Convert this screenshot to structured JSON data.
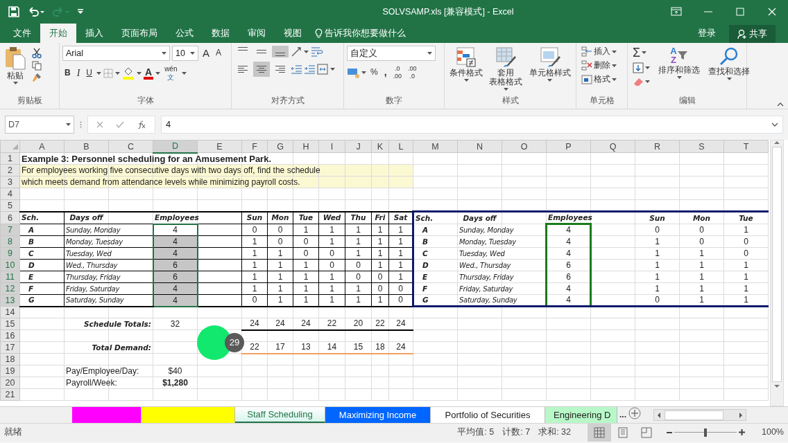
{
  "window": {
    "title": "SOLVSAMP.xls  [兼容模式] - Excel"
  },
  "ribbon_tabs": [
    {
      "label": "文件",
      "selected": false
    },
    {
      "label": "开始",
      "selected": true
    },
    {
      "label": "插入",
      "selected": false
    },
    {
      "label": "页面布局",
      "selected": false
    },
    {
      "label": "公式",
      "selected": false
    },
    {
      "label": "数据",
      "selected": false
    },
    {
      "label": "审阅",
      "selected": false
    },
    {
      "label": "视图",
      "selected": false
    }
  ],
  "tell_me": {
    "placeholder": "告诉我你想要做什么"
  },
  "account": {
    "sign_in": "登录",
    "share": "共享"
  },
  "ribbon": {
    "clipboard": {
      "paste": "粘贴",
      "label": "剪贴板"
    },
    "font": {
      "font_name": "Arial",
      "font_size": "10",
      "grow": "A",
      "shrink": "A",
      "bold": "B",
      "italic": "I",
      "underline": "U",
      "font_color": "A",
      "phonetic": [
        "wén",
        "文"
      ],
      "label": "字体"
    },
    "alignment": {
      "vertical": [
        {
          "selected": false
        },
        {
          "selected": false
        },
        {
          "selected": true
        }
      ],
      "horizontal": [
        {
          "selected": false
        },
        {
          "selected": true
        },
        {
          "selected": false
        }
      ],
      "label": "对齐方式"
    },
    "number": {
      "format": "自定义",
      "percent": "%",
      "comma": ",",
      "decimals": [
        {
          "lines": [
            ".0",
            ".00"
          ]
        },
        {
          "lines": [
            ".00",
            ".0"
          ]
        }
      ],
      "label": "数字"
    },
    "styles": {
      "buttons": [
        {
          "lines": [
            "条件格式"
          ]
        },
        {
          "lines": [
            "套用",
            "表格格式"
          ]
        },
        {
          "lines": [
            "单元格样式"
          ]
        }
      ],
      "label": "样式"
    },
    "cells": {
      "items": [
        "插入",
        "删除",
        "格式"
      ],
      "label": "单元格"
    },
    "editing": {
      "sum": "Σ",
      "sort_letters": [
        "A",
        "Z"
      ],
      "buttons": [
        "排序和筛选",
        "查找和选择"
      ],
      "label": "编辑"
    }
  },
  "formula_bar": {
    "name_box": "D7",
    "formula": "4"
  },
  "columns": [
    {
      "label": "A",
      "selected": false
    },
    {
      "label": "B",
      "selected": false
    },
    {
      "label": "C",
      "selected": false
    },
    {
      "label": "D",
      "selected": true
    },
    {
      "label": "E",
      "selected": false
    },
    {
      "label": "F",
      "selected": false
    },
    {
      "label": "G",
      "selected": false
    },
    {
      "label": "H",
      "selected": false
    },
    {
      "label": "I",
      "selected": false
    },
    {
      "label": "J",
      "selected": false
    },
    {
      "label": "K",
      "selected": false
    },
    {
      "label": "L",
      "selected": false
    },
    {
      "label": "M",
      "selected": false
    },
    {
      "label": "N",
      "selected": false
    },
    {
      "label": "O",
      "selected": false
    },
    {
      "label": "P",
      "selected": false
    },
    {
      "label": "Q",
      "selected": false
    },
    {
      "label": "R",
      "selected": false
    },
    {
      "label": "S",
      "selected": false
    },
    {
      "label": "T",
      "selected": false
    }
  ],
  "row_headers": [
    {
      "label": "1",
      "selected": false
    },
    {
      "label": "2",
      "selected": false
    },
    {
      "label": "3",
      "selected": false
    },
    {
      "label": "4",
      "selected": false
    },
    {
      "label": "5",
      "selected": false
    },
    {
      "label": "6",
      "selected": false
    },
    {
      "label": "7",
      "selected": true
    },
    {
      "label": "8",
      "selected": true
    },
    {
      "label": "9",
      "selected": true
    },
    {
      "label": "10",
      "selected": true
    },
    {
      "label": "11",
      "selected": true
    },
    {
      "label": "12",
      "selected": true
    },
    {
      "label": "13",
      "selected": true
    },
    {
      "label": "14",
      "selected": false
    },
    {
      "label": "15",
      "selected": false
    },
    {
      "label": "16",
      "selected": false
    },
    {
      "label": "17",
      "selected": false
    },
    {
      "label": "18",
      "selected": false
    },
    {
      "label": "19",
      "selected": false
    },
    {
      "label": "20",
      "selected": false
    },
    {
      "label": "21",
      "selected": false
    }
  ],
  "sheet": {
    "title": "Example 3:  Personnel scheduling for an Amusement Park.",
    "description": [
      "For employees working five consecutive days with two days off, find the schedule",
      "which meets demand from attendance levels while minimizing payroll costs."
    ],
    "left_table": {
      "headers": {
        "sch": "Sch.",
        "days_off": "Days off",
        "employees": "Employees",
        "days": [
          "Sun",
          "Mon",
          "Tue",
          "Wed",
          "Thu",
          "Fri",
          "Sat"
        ]
      },
      "rows": [
        {
          "sch": "A",
          "days_off": "Sunday, Monday",
          "employees": "4",
          "selected": true,
          "active": true,
          "days": [
            "0",
            "0",
            "1",
            "1",
            "1",
            "1",
            "1"
          ]
        },
        {
          "sch": "B",
          "days_off": "Monday, Tuesday",
          "employees": "4",
          "selected": true,
          "active": false,
          "days": [
            "1",
            "0",
            "0",
            "1",
            "1",
            "1",
            "1"
          ]
        },
        {
          "sch": "C",
          "days_off": "Tuesday, Wed",
          "employees": "4",
          "selected": true,
          "active": false,
          "days": [
            "1",
            "1",
            "0",
            "0",
            "1",
            "1",
            "1"
          ]
        },
        {
          "sch": "D",
          "days_off": "Wed., Thursday",
          "employees": "6",
          "selected": true,
          "active": false,
          "days": [
            "1",
            "1",
            "1",
            "0",
            "0",
            "1",
            "1"
          ]
        },
        {
          "sch": "E",
          "days_off": "Thursday, Friday",
          "employees": "6",
          "selected": true,
          "active": false,
          "days": [
            "1",
            "1",
            "1",
            "1",
            "0",
            "0",
            "1"
          ]
        },
        {
          "sch": "F",
          "days_off": "Friday, Saturday",
          "employees": "4",
          "selected": true,
          "active": false,
          "days": [
            "1",
            "1",
            "1",
            "1",
            "1",
            "0",
            "0"
          ]
        },
        {
          "sch": "G",
          "days_off": "Saturday, Sunday",
          "employees": "4",
          "selected": true,
          "active": false,
          "days": [
            "0",
            "1",
            "1",
            "1",
            "1",
            "1",
            "0"
          ]
        }
      ]
    },
    "right_table": {
      "headers": {
        "sch": "Sch.",
        "days_off": "Days off",
        "employees": "Employees",
        "days": [
          "Sun",
          "Mon",
          "Tue"
        ]
      },
      "rows": [
        {
          "sch": "A",
          "days_off": "Sunday, Monday",
          "employees": "4",
          "days": [
            "0",
            "0",
            "1"
          ]
        },
        {
          "sch": "B",
          "days_off": "Monday, Tuesday",
          "employees": "4",
          "days": [
            "1",
            "0",
            "0"
          ]
        },
        {
          "sch": "C",
          "days_off": "Tuesday, Wed",
          "employees": "4",
          "days": [
            "1",
            "1",
            "0"
          ]
        },
        {
          "sch": "D",
          "days_off": "Wed., Thursday",
          "employees": "6",
          "days": [
            "1",
            "1",
            "1"
          ]
        },
        {
          "sch": "E",
          "days_off": "Thursday, Friday",
          "employees": "6",
          "days": [
            "1",
            "1",
            "1"
          ]
        },
        {
          "sch": "F",
          "days_off": "Friday, Saturday",
          "employees": "4",
          "days": [
            "1",
            "1",
            "1"
          ]
        },
        {
          "sch": "G",
          "days_off": "Saturday, Sunday",
          "employees": "4",
          "days": [
            "0",
            "1",
            "1"
          ]
        }
      ]
    },
    "schedule_totals": {
      "label": "Schedule Totals:",
      "total": "32",
      "days": [
        "24",
        "24",
        "24",
        "22",
        "20",
        "22",
        "24"
      ]
    },
    "total_demand": {
      "label": "Total Demand:",
      "days": [
        "22",
        "17",
        "13",
        "14",
        "15",
        "18",
        "24"
      ]
    },
    "pay_per_day": {
      "label": "Pay/Employee/Day:",
      "value": "$40"
    },
    "payroll": {
      "label": "Payroll/Week:",
      "value": "$1,280"
    }
  },
  "click_marker": {
    "step": "29"
  },
  "sheet_tabs": [
    {
      "color": "#ff00ff",
      "selected": false
    },
    {
      "color": "#ffff00",
      "selected": false
    },
    {
      "label": "Staff Scheduling",
      "color": "#d8f5ee",
      "selected": true
    },
    {
      "label": "Maximizing Income",
      "color": "#0066ff",
      "selected": false
    },
    {
      "label": "Portfolio of Securities",
      "color": "#ffffff",
      "selected": false
    },
    {
      "label": "Engineering D",
      "color": "#b8f8c8",
      "selected": false
    }
  ],
  "more_tabs": "...",
  "status_bar": {
    "state": "就绪",
    "average": "平均值: 5",
    "count": "计数: 7",
    "sum": "求和: 32",
    "zoom": "100%",
    "zoom_level": {
      "level": 0.5
    }
  }
}
